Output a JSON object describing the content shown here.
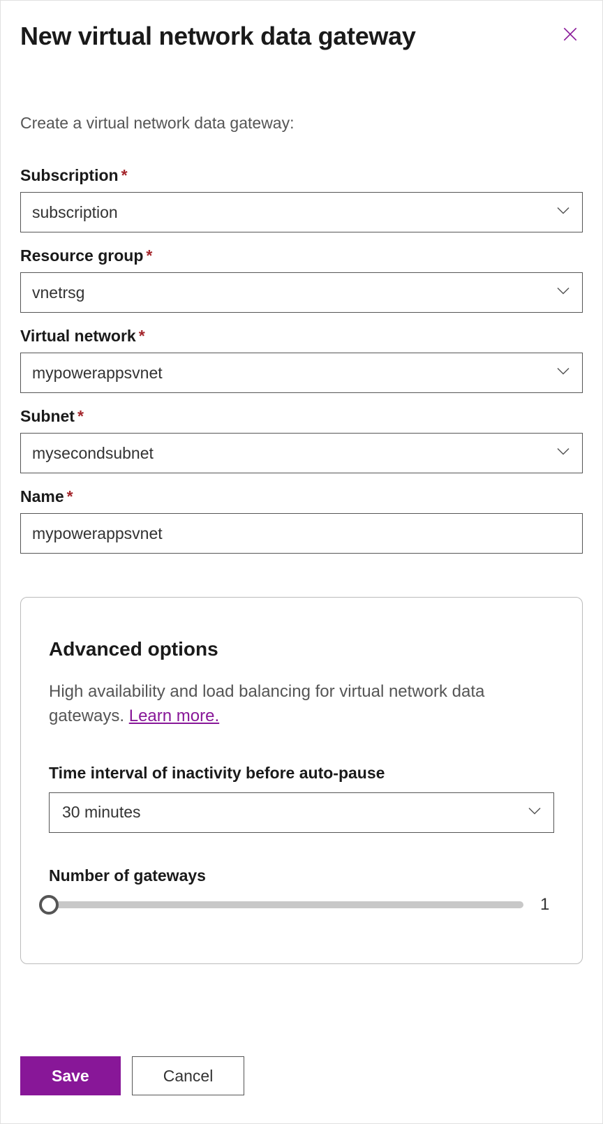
{
  "header": {
    "title": "New virtual network data gateway",
    "subtitle": "Create a virtual network data gateway:"
  },
  "fields": {
    "subscription": {
      "label": "Subscription",
      "value": "subscription"
    },
    "resource_group": {
      "label": "Resource group",
      "value": "vnetrsg"
    },
    "virtual_network": {
      "label": "Virtual network",
      "value": "mypowerappsvnet"
    },
    "subnet": {
      "label": "Subnet",
      "value": "mysecondsubnet"
    },
    "name": {
      "label": "Name",
      "value": "mypowerappsvnet"
    }
  },
  "advanced": {
    "title": "Advanced options",
    "description": "High availability and load balancing for virtual network data gateways. ",
    "learn_more": "Learn more.",
    "inactivity": {
      "label": "Time interval of inactivity before auto-pause",
      "value": "30 minutes"
    },
    "gateways": {
      "label": "Number of gateways",
      "value": "1"
    }
  },
  "footer": {
    "save": "Save",
    "cancel": "Cancel"
  }
}
